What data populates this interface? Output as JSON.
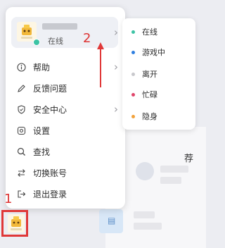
{
  "profile": {
    "status": "在线",
    "status_color": "#3cc3a4"
  },
  "menu": {
    "items": [
      {
        "label": "帮助",
        "icon": "info-icon",
        "has_submenu": true
      },
      {
        "label": "反馈问题",
        "icon": "pencil-icon",
        "has_submenu": false
      },
      {
        "label": "安全中心",
        "icon": "shield-icon",
        "has_submenu": true
      },
      {
        "label": "设置",
        "icon": "gear-icon",
        "has_submenu": false
      },
      {
        "label": "查找",
        "icon": "search-icon",
        "has_submenu": false
      },
      {
        "label": "切换账号",
        "icon": "switch-icon",
        "has_submenu": false
      },
      {
        "label": "退出登录",
        "icon": "logout-icon",
        "has_submenu": false
      }
    ]
  },
  "status_menu": {
    "items": [
      {
        "label": "在线",
        "color": "#3cc3a4"
      },
      {
        "label": "游戏中",
        "color": "#2f7fe0"
      },
      {
        "label": "离开",
        "color": "#c8c8cc"
      },
      {
        "label": "忙碌",
        "color": "#e0466b"
      },
      {
        "label": "隐身",
        "color": "#f2a23c"
      }
    ]
  },
  "background": {
    "section_title": "荐"
  },
  "annotations": {
    "marker_1": "1",
    "marker_2": "2",
    "color": "#e03838"
  }
}
